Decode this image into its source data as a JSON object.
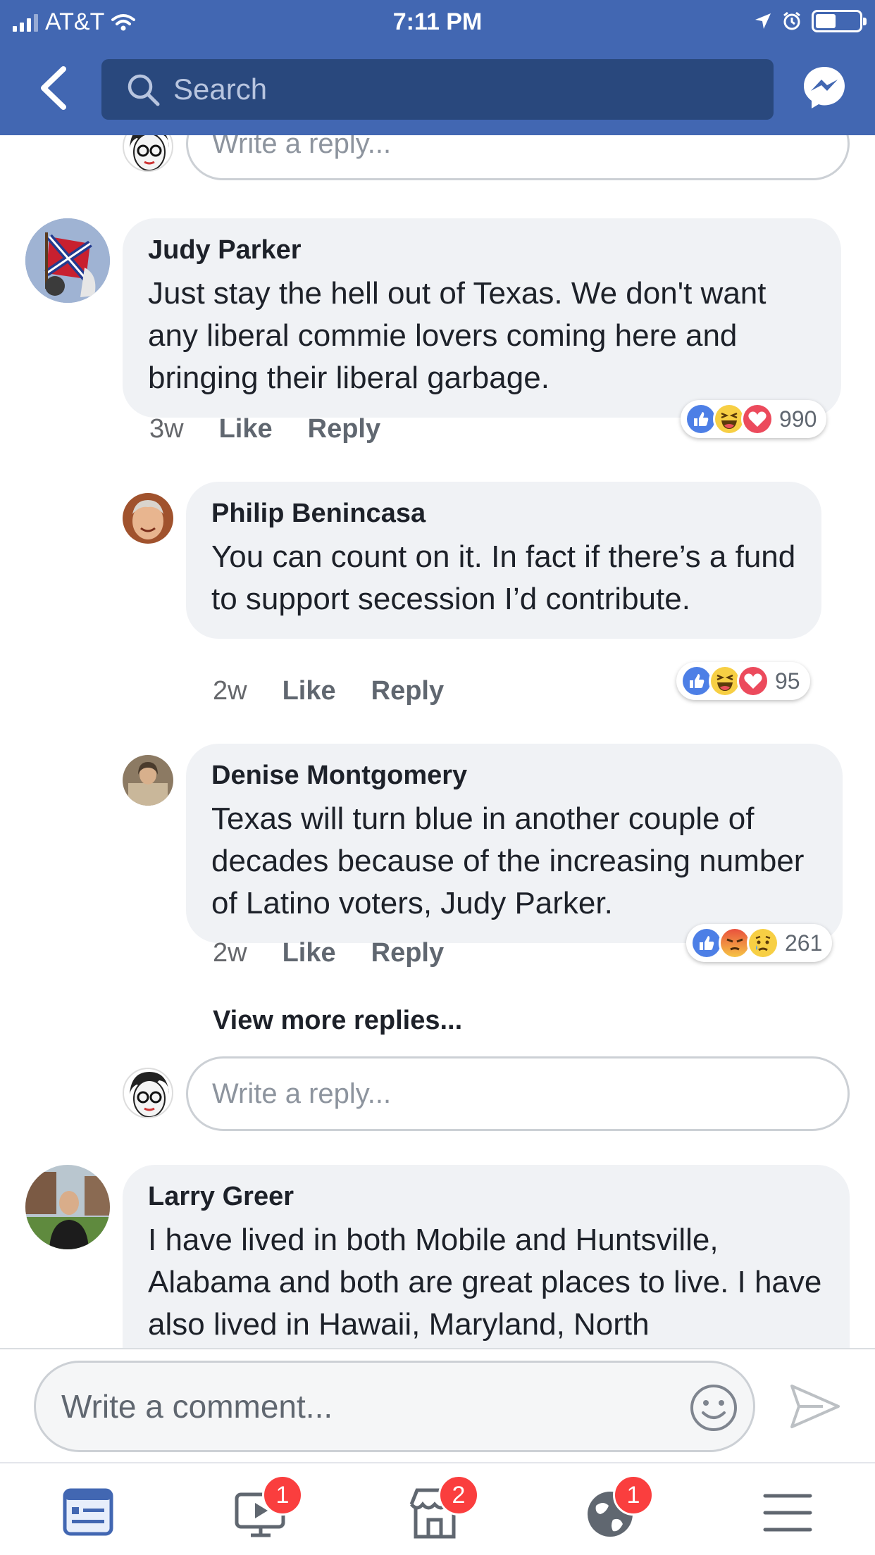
{
  "status_bar": {
    "carrier": "AT&T",
    "time": "7:11 PM"
  },
  "header": {
    "search_placeholder": "Search"
  },
  "comments": [
    {
      "author": "Judy Parker",
      "text": "Just stay the hell out of Texas. We don't want any liberal commie lovers coming here and bringing their liberal garbage.",
      "age": "3w",
      "like_label": "Like",
      "reply_label": "Reply",
      "reactions": [
        "like",
        "haha",
        "love"
      ],
      "reaction_count": "990"
    },
    {
      "author": "Philip Benincasa",
      "text": "You can count on it.  In fact if there’s a fund to support secession I’d contribute.",
      "age": "2w",
      "like_label": "Like",
      "reply_label": "Reply",
      "reactions": [
        "like",
        "haha",
        "love"
      ],
      "reaction_count": "95"
    },
    {
      "author": "Denise Montgomery",
      "text": "Texas will turn blue in another couple of decades because of the increasing number of Latino voters, Judy Parker.",
      "age": "2w",
      "like_label": "Like",
      "reply_label": "Reply",
      "reactions": [
        "like",
        "angry",
        "sad"
      ],
      "reaction_count": "261"
    },
    {
      "author": "Larry Greer",
      "text": "I have lived in both Mobile and Huntsville, Alabama and both are great places to live. I have also lived in Hawaii, Maryland, North"
    }
  ],
  "reply_placeholder": "Write a reply...",
  "view_more_replies": "View more replies...",
  "composer": {
    "placeholder": "Write a comment..."
  },
  "tabbar": {
    "badges": {
      "watch": "1",
      "marketplace": "2",
      "notifications": "1"
    }
  },
  "colors": {
    "brand": "#4267b2",
    "search_bg": "#29487d",
    "bubble": "#f0f2f5",
    "badge": "#fa3e3e"
  }
}
